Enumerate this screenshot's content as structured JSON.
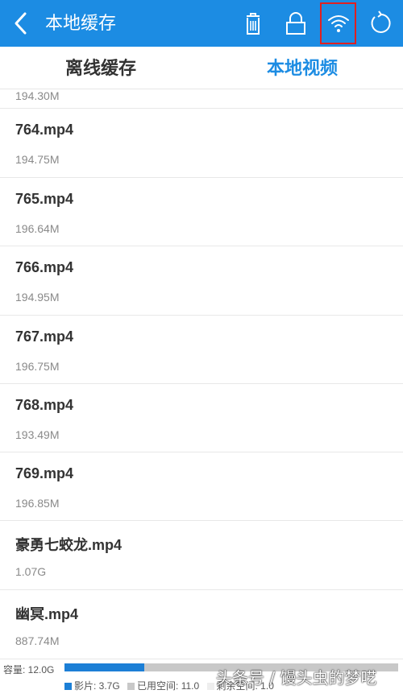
{
  "header": {
    "title": "本地缓存",
    "icons": [
      "chevron-left-icon",
      "trash-icon",
      "lock-icon",
      "wifi-icon",
      "refresh-icon"
    ]
  },
  "tabs": [
    {
      "label": "离线缓存",
      "active": false
    },
    {
      "label": "本地视频",
      "active": true
    }
  ],
  "files": [
    {
      "name": "",
      "size": "194.30M"
    },
    {
      "name": "764.mp4",
      "size": "194.75M"
    },
    {
      "name": "765.mp4",
      "size": "196.64M"
    },
    {
      "name": "766.mp4",
      "size": "194.95M"
    },
    {
      "name": "767.mp4",
      "size": "196.75M"
    },
    {
      "name": "768.mp4",
      "size": "193.49M"
    },
    {
      "name": "769.mp4",
      "size": "196.85M"
    },
    {
      "name": "豪勇七蛟龙.mp4",
      "size": "1.07G"
    },
    {
      "name": "幽冥.mp4",
      "size": "887.74M"
    }
  ],
  "storage": {
    "capacity_label": "容量: 12.0G",
    "video_label": "影片: 3.7G",
    "used_label": "已用空间: 11.0",
    "free_label": "剩余空间: 1.0",
    "video_fraction": 0.24,
    "colors": {
      "video": "#1c7fd6",
      "used": "#c8c8c8",
      "free": "#eeeeee"
    }
  },
  "watermark": "头条号 / 馒头虫的梦呓",
  "colors": {
    "accent": "#1c8ce3",
    "highlight": "#e02020"
  }
}
